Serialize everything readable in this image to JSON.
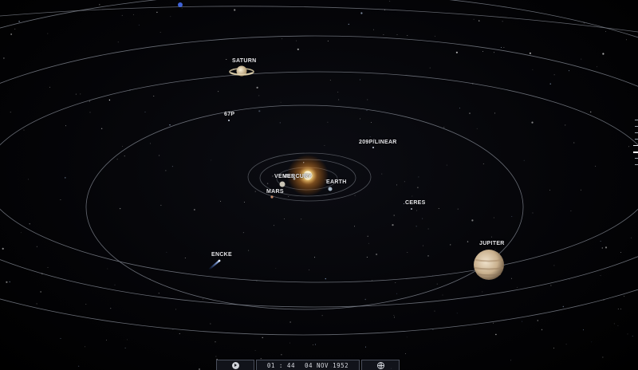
{
  "bodies": {
    "sun": {
      "name": "MERCURY",
      "icon": "sun-icon"
    },
    "mercury": {
      "label": "MERCURY"
    },
    "venus": {
      "label": "VENUS"
    },
    "earth": {
      "label": "EARTH"
    },
    "mars": {
      "label": "MARS"
    },
    "jupiter": {
      "label": "JUPITER"
    },
    "saturn": {
      "label": "SATURN"
    },
    "ceres": {
      "label": "CERES"
    },
    "comet_67p": {
      "label": "67P"
    },
    "comet_209p": {
      "label": "209P/LINEAR"
    },
    "encke": {
      "label": "ENCKE"
    }
  },
  "timebar": {
    "play_icon": "play-icon",
    "time": "01 : 44",
    "date": "04 NOV 1952",
    "view_icon": "globe-icon"
  },
  "colors": {
    "background": "#000000",
    "orbit": "#8a8f99",
    "label": "#e6e6ea",
    "sun_core": "#fff4c8",
    "sun_glow": "#ffb347"
  }
}
